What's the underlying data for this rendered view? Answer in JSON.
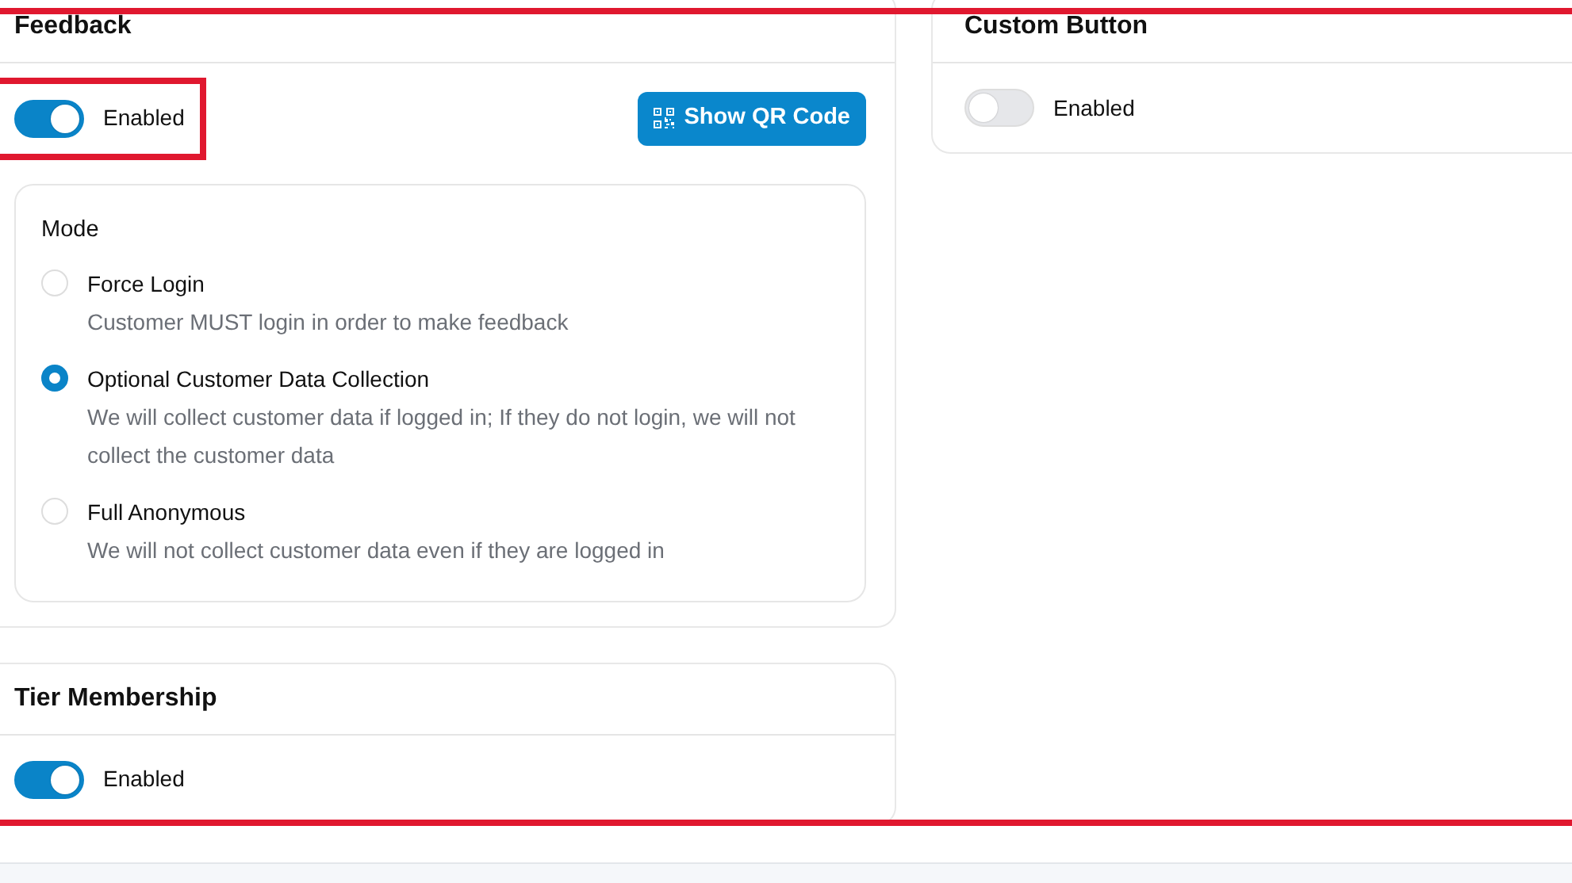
{
  "annotation_frame": true,
  "left_column": [
    {
      "title": "Feedback",
      "toggle": {
        "label": "Enabled",
        "on": true,
        "highlighted": true
      },
      "button": {
        "label": "Show QR Code"
      },
      "mode": {
        "title": "Mode",
        "options": [
          {
            "label": "Force Login",
            "description": "Customer MUST login in order to make feedback",
            "selected": false
          },
          {
            "label": "Optional Customer Data Collection",
            "description": "We will collect customer data if logged in; If they do not login, we will not collect the customer data",
            "selected": true
          },
          {
            "label": "Full Anonymous",
            "description": "We will not collect customer data even if they are logged in",
            "selected": false
          }
        ]
      }
    },
    {
      "title": "Tier Membership",
      "toggle": {
        "label": "Enabled",
        "on": true
      }
    }
  ],
  "right_column": [
    {
      "title": "Custom Button",
      "toggle": {
        "label": "Enabled",
        "on": false
      }
    }
  ]
}
